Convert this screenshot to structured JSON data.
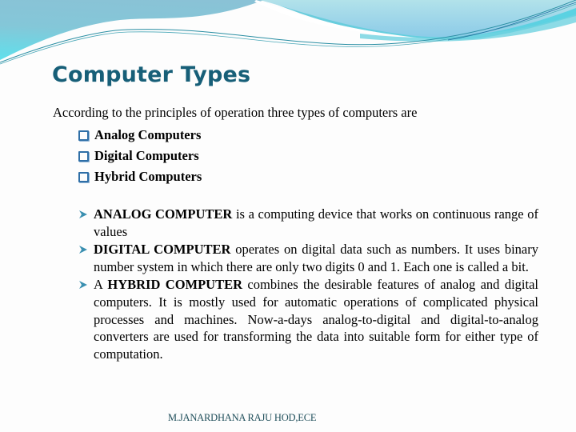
{
  "slide": {
    "title": "Computer Types",
    "intro": "According to the principles of operation three types of computers are",
    "types": [
      {
        "label": "Analog Computers",
        "icon": "checkbox-square-icon"
      },
      {
        "label": "Digital Computers",
        "icon": "checkbox-square-icon"
      },
      {
        "label": "Hybrid Computers",
        "icon": "checkbox-square-icon"
      }
    ],
    "descriptions": [
      {
        "prefix": "",
        "term": "ANALOG COMPUTER",
        "text": " is a computing device that works on continuous range of values",
        "icon": "arrow-right-icon"
      },
      {
        "prefix": "",
        "term": "DIGITAL COMPUTER",
        "text": " operates on digital data such as numbers. It uses binary number system in which there are only two digits 0 and 1. Each one is called a bit.",
        "icon": "arrow-right-icon"
      },
      {
        "prefix": "A ",
        "term": "HYBRID COMPUTER",
        "text": " combines the desirable features of analog and digital computers. It is mostly used for automatic operations of complicated physical processes and machines. Now-a-days analog-to-digital and digital-to-analog converters are used for transforming the data into suitable form for either type of computation.",
        "icon": "arrow-right-icon"
      }
    ],
    "footer": "M.JANARDHANA RAJU HOD,ECE"
  },
  "colors": {
    "title": "#175f78",
    "bullet_square": "#2f6fa7",
    "arrow": "#3a8fb0",
    "header_wave_dark": "#84c3d6",
    "header_wave_light": "#a9dde8",
    "header_wave_cyan": "#5fd6e6",
    "footer": "#1f4e5a"
  }
}
